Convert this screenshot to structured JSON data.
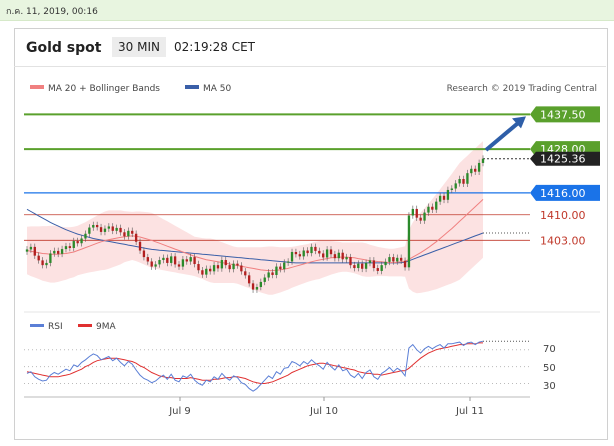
{
  "timestamp": "ก.ค. 11, 2019, 00:16",
  "header": {
    "title": "Gold spot",
    "timeframe": "30 MIN",
    "time": "02:19:28 CET"
  },
  "copyright": "Research © 2019 Trading Central",
  "colors": {
    "ma20": "#f08080",
    "ma50": "#3a5fa8",
    "band": "#fbd8d8",
    "bull": "#2b8a2b",
    "bear": "#b22020",
    "green_level": "#5aa02c",
    "blue_level": "#1a73e8",
    "red_level": "#c0392b",
    "rsi": "#5b7fd6",
    "rsi_ma": "#e03030"
  },
  "chart_data": [
    {
      "type": "candlestick",
      "title": "",
      "ylim": [
        1385,
        1442
      ],
      "x_ticks": [
        "Jul 9",
        "Jul 10",
        "Jul 11"
      ],
      "legend": [
        {
          "name": "MA 20 + Bollinger Bands",
          "color": "#f08080"
        },
        {
          "name": "MA 50",
          "color": "#3a5fa8"
        }
      ],
      "current_price": 1425.36,
      "levels": [
        {
          "label": "1437.50",
          "value": 1437.5,
          "style": "green-tag"
        },
        {
          "label": "1428.00",
          "value": 1428.0,
          "style": "green-tag"
        },
        {
          "label": "1425.36",
          "value": 1425.36,
          "style": "price-tag"
        },
        {
          "label": "1416.00",
          "value": 1416.0,
          "style": "blue-tag"
        },
        {
          "label": "1410.00",
          "value": 1410.0,
          "style": "red-text"
        },
        {
          "label": "1403.00",
          "value": 1403.0,
          "style": "red-text"
        }
      ],
      "close": [
        1400.5,
        1401.2,
        1398.8,
        1397.5,
        1396.2,
        1396.8,
        1399.4,
        1400.1,
        1399.3,
        1400.6,
        1401.4,
        1400.9,
        1402.8,
        1402.2,
        1403.5,
        1404.8,
        1406.5,
        1407.2,
        1406.6,
        1405.3,
        1406.2,
        1406.8,
        1405.6,
        1406.4,
        1405.2,
        1404.1,
        1405.6,
        1404.8,
        1402.6,
        1400.2,
        1398.4,
        1397.2,
        1395.8,
        1396.4,
        1397.6,
        1398.2,
        1396.8,
        1398.6,
        1396.4,
        1395.8,
        1397.8,
        1397.2,
        1398.4,
        1396.5,
        1394.8,
        1393.6,
        1395.2,
        1394.5,
        1396.2,
        1395.3,
        1397.6,
        1396.2,
        1395.1,
        1396.6,
        1396.1,
        1394.5,
        1393.4,
        1391.2,
        1389.5,
        1390.2,
        1391.6,
        1392.8,
        1394.2,
        1393.5,
        1395.8,
        1395.1,
        1396.9,
        1397.2,
        1399.8,
        1399.2,
        1398.6,
        1400.2,
        1399.5,
        1401.2,
        1400.1,
        1399.4,
        1398.3,
        1400.5,
        1399.2,
        1398.1,
        1399.6,
        1397.8,
        1398.4,
        1396.2,
        1395.4,
        1396.6,
        1395.2,
        1396.8,
        1397.5,
        1395.4,
        1394.6,
        1396.2,
        1397.1,
        1398.4,
        1397.2,
        1398.2,
        1397.4,
        1395.6,
        1409.8,
        1411.6,
        1409.2,
        1408.4,
        1410.6,
        1412.2,
        1411.4,
        1413.6,
        1415.2,
        1414.1,
        1416.8,
        1417.2,
        1418.6,
        1419.8,
        1418.5,
        1421.4,
        1422.6,
        1421.8,
        1424.2,
        1425.36
      ],
      "ma20": [
        1400.2,
        1400.0,
        1399.8,
        1399.6,
        1399.4,
        1399.3,
        1399.2,
        1399.2,
        1399.2,
        1399.3,
        1399.4,
        1399.6,
        1399.8,
        1400.2,
        1400.6,
        1401.0,
        1401.4,
        1401.8,
        1402.2,
        1402.6,
        1402.9,
        1403.2,
        1403.4,
        1403.6,
        1403.8,
        1404.0,
        1404.1,
        1404.2,
        1404.1,
        1403.9,
        1403.6,
        1403.3,
        1403.0,
        1402.6,
        1402.2,
        1401.8,
        1401.4,
        1401.0,
        1400.6,
        1400.2,
        1399.8,
        1399.4,
        1399.0,
        1398.6,
        1398.3,
        1398.0,
        1397.7,
        1397.5,
        1397.3,
        1397.1,
        1396.9,
        1396.7,
        1396.5,
        1396.3,
        1396.1,
        1395.9,
        1395.7,
        1395.5,
        1395.3,
        1395.1,
        1394.9,
        1394.8,
        1394.7,
        1394.7,
        1394.8,
        1394.9,
        1395.1,
        1395.3,
        1395.6,
        1395.9,
        1396.2,
        1396.5,
        1396.8,
        1397.1,
        1397.4,
        1397.6,
        1397.8,
        1398.0,
        1398.2,
        1398.3,
        1398.4,
        1398.4,
        1398.4,
        1398.3,
        1398.2,
        1398.0,
        1397.8,
        1397.6,
        1397.4,
        1397.3,
        1397.2,
        1397.1,
        1397.0,
        1396.9,
        1396.9,
        1397.0,
        1397.1,
        1397.2,
        1397.8,
        1398.4,
        1399.0,
        1399.6,
        1400.3,
        1401.0,
        1401.8,
        1402.6,
        1403.5,
        1404.4,
        1405.3,
        1406.2,
        1407.2,
        1408.2,
        1409.2,
        1410.2,
        1411.2,
        1412.2,
        1413.2,
        1414.2
      ],
      "ma50": [
        1411.5,
        1410.9,
        1410.3,
        1409.7,
        1409.1,
        1408.5,
        1407.9,
        1407.4,
        1406.9,
        1406.4,
        1405.9,
        1405.5,
        1405.1,
        1404.7,
        1404.4,
        1404.1,
        1403.8,
        1403.5,
        1403.3,
        1403.1,
        1402.9,
        1402.7,
        1402.5,
        1402.3,
        1402.1,
        1401.9,
        1401.7,
        1401.5,
        1401.3,
        1401.1,
        1400.9,
        1400.7,
        1400.5,
        1400.4,
        1400.3,
        1400.2,
        1400.1,
        1400.0,
        1399.9,
        1399.8,
        1399.7,
        1399.6,
        1399.5,
        1399.4,
        1399.3,
        1399.2,
        1399.1,
        1399.0,
        1398.9,
        1398.8,
        1398.7,
        1398.6,
        1398.5,
        1398.4,
        1398.3,
        1398.2,
        1398.1,
        1398.0,
        1397.9,
        1397.8,
        1397.7,
        1397.6,
        1397.5,
        1397.4,
        1397.3,
        1397.2,
        1397.1,
        1397.0,
        1396.9,
        1396.8,
        1396.8,
        1396.8,
        1396.8,
        1396.8,
        1396.8,
        1396.8,
        1396.8,
        1396.8,
        1396.8,
        1396.8,
        1396.8,
        1396.8,
        1396.8,
        1396.8,
        1396.8,
        1396.8,
        1396.8,
        1396.8,
        1396.8,
        1396.8,
        1396.8,
        1396.8,
        1396.8,
        1396.8,
        1396.8,
        1396.8,
        1396.9,
        1397.0,
        1397.4,
        1397.8,
        1398.2,
        1398.6,
        1399.0,
        1399.4,
        1399.8,
        1400.2,
        1400.6,
        1401.0,
        1401.4,
        1401.8,
        1402.2,
        1402.6,
        1403.0,
        1403.4,
        1403.8,
        1404.2,
        1404.6,
        1405.0
      ],
      "band_width": [
        6.5,
        6.8,
        7.0,
        7.2,
        7.5,
        7.6,
        7.8,
        7.8,
        7.6,
        7.4,
        7.2,
        7.0,
        6.9,
        6.8,
        6.9,
        7.0,
        7.2,
        7.4,
        7.6,
        7.8,
        8.0,
        8.0,
        7.8,
        7.6,
        7.4,
        7.0,
        6.8,
        6.6,
        6.8,
        7.0,
        7.2,
        7.4,
        7.5,
        7.4,
        7.2,
        7.0,
        6.8,
        6.6,
        6.4,
        6.2,
        6.0,
        5.8,
        5.6,
        5.4,
        5.5,
        5.6,
        5.8,
        6.0,
        6.0,
        5.8,
        5.6,
        5.4,
        5.2,
        5.0,
        5.0,
        5.2,
        5.4,
        5.6,
        5.8,
        6.0,
        6.2,
        6.4,
        6.6,
        6.6,
        6.4,
        6.2,
        6.0,
        5.8,
        5.6,
        5.5,
        5.4,
        5.3,
        5.2,
        5.2,
        5.2,
        5.2,
        5.0,
        4.8,
        4.6,
        4.4,
        4.2,
        4.0,
        4.0,
        4.1,
        4.2,
        4.4,
        4.6,
        4.6,
        4.4,
        4.2,
        4.0,
        3.9,
        3.8,
        3.8,
        3.8,
        3.9,
        4.0,
        4.2,
        8.0,
        9.5,
        10.5,
        11.0,
        11.5,
        12.0,
        12.5,
        13.0,
        13.5,
        14.0,
        14.5,
        15.0,
        15.5,
        16.0,
        16.0,
        16.0,
        16.0,
        16.0,
        16.0,
        16.0
      ]
    },
    {
      "type": "line",
      "title": "",
      "ylim": [
        20,
        85
      ],
      "y_ticks": [
        "70",
        "50",
        "30"
      ],
      "legend": [
        {
          "name": "RSI",
          "color": "#5b7fd6"
        },
        {
          "name": "9MA",
          "color": "#e03030"
        }
      ],
      "series": [
        {
          "name": "RSI",
          "values": [
            42,
            44,
            38,
            35,
            33,
            34,
            40,
            43,
            41,
            44,
            47,
            45,
            52,
            50,
            55,
            58,
            62,
            65,
            63,
            58,
            60,
            62,
            57,
            60,
            55,
            51,
            56,
            53,
            46,
            40,
            36,
            34,
            31,
            33,
            37,
            40,
            35,
            41,
            34,
            32,
            39,
            37,
            41,
            34,
            30,
            28,
            34,
            32,
            38,
            35,
            42,
            37,
            34,
            39,
            37,
            31,
            29,
            24,
            21,
            24,
            29,
            34,
            39,
            36,
            44,
            41,
            48,
            49,
            56,
            54,
            51,
            56,
            53,
            58,
            54,
            51,
            47,
            55,
            50,
            46,
            52,
            45,
            47,
            40,
            37,
            42,
            36,
            43,
            46,
            38,
            35,
            42,
            45,
            49,
            44,
            48,
            45,
            39,
            72,
            76,
            70,
            66,
            71,
            74,
            71,
            74,
            76,
            72,
            77,
            77,
            78,
            79,
            75,
            78,
            79,
            76,
            79,
            80
          ]
        },
        {
          "name": "9MA",
          "values": [
            44,
            43,
            42,
            41,
            40,
            39,
            38,
            38,
            38,
            39,
            40,
            41,
            43,
            45,
            47,
            50,
            52,
            55,
            57,
            58,
            59,
            60,
            60,
            60,
            59,
            58,
            57,
            56,
            54,
            51,
            49,
            46,
            43,
            41,
            39,
            38,
            37,
            37,
            36,
            36,
            36,
            36,
            37,
            36,
            35,
            34,
            34,
            34,
            35,
            35,
            36,
            37,
            37,
            38,
            38,
            37,
            36,
            34,
            32,
            31,
            30,
            30,
            31,
            32,
            34,
            36,
            38,
            40,
            43,
            45,
            47,
            49,
            51,
            52,
            53,
            54,
            54,
            53,
            52,
            51,
            50,
            49,
            48,
            47,
            46,
            44,
            43,
            42,
            42,
            41,
            41,
            40,
            41,
            42,
            43,
            44,
            45,
            45,
            48,
            52,
            56,
            60,
            63,
            66,
            68,
            70,
            71,
            72,
            73,
            74,
            75,
            76,
            76,
            77,
            77,
            77,
            78,
            78
          ]
        }
      ],
      "levels": [
        70,
        50,
        30
      ]
    }
  ]
}
